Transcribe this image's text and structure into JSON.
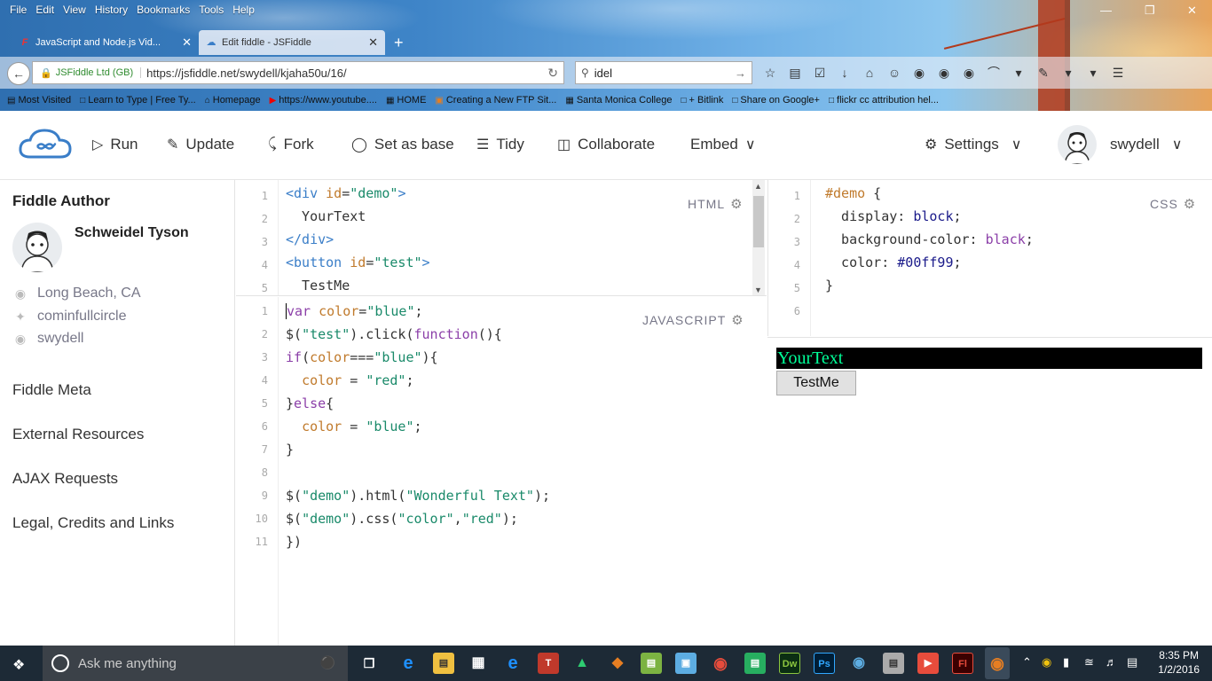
{
  "browser": {
    "menu": [
      "File",
      "Edit",
      "View",
      "History",
      "Bookmarks",
      "Tools",
      "Help"
    ],
    "tabs": [
      {
        "title": "JavaScript and Node.js Vid..."
      },
      {
        "title": "Edit fiddle - JSFiddle"
      }
    ],
    "site_label": "JSFiddle Ltd (GB)",
    "url": "https://jsfiddle.net/swydell/kjaha50u/16/",
    "search_value": "idel",
    "bookmarks": [
      "Most Visited",
      "Learn to Type | Free Ty...",
      "Homepage",
      "https://www.youtube....",
      "HOME",
      "Creating a New FTP Sit...",
      "Santa Monica College",
      "+ Bitlink",
      "Share on Google+",
      "flickr cc attribution hel..."
    ]
  },
  "header": {
    "run": "Run",
    "update": "Update",
    "fork": "Fork",
    "set_as_base": "Set as base",
    "tidy": "Tidy",
    "collaborate": "Collaborate",
    "embed": "Embed",
    "settings": "Settings",
    "username": "swydell"
  },
  "sidebar": {
    "heading": "Fiddle Author",
    "author_name": "Schweidel Tyson",
    "location": "Long Beach, CA",
    "twitter": "cominfullcircle",
    "github": "swydell",
    "links": [
      "Fiddle Meta",
      "External Resources",
      "AJAX Requests",
      "Legal, Credits and Links"
    ]
  },
  "editors": {
    "html_label": "HTML",
    "css_label": "CSS",
    "js_label": "JAVASCRIPT",
    "html_lines": [
      "1",
      "2",
      "3",
      "4",
      "5"
    ],
    "css_lines": [
      "1",
      "2",
      "3",
      "4",
      "5",
      "6"
    ],
    "js_lines": [
      "1",
      "2",
      "3",
      "4",
      "5",
      "6",
      "7",
      "8",
      "9",
      "10",
      "11"
    ]
  },
  "result": {
    "demo_text": "YourText",
    "button_text": "TestMe"
  },
  "taskbar": {
    "search_placeholder": "Ask me anything",
    "time": "8:35 PM",
    "date": "1/2/2016"
  },
  "colors": {
    "accent": "#3a7ec8",
    "demo_bg": "#000000",
    "demo_fg": "#00ff99"
  }
}
